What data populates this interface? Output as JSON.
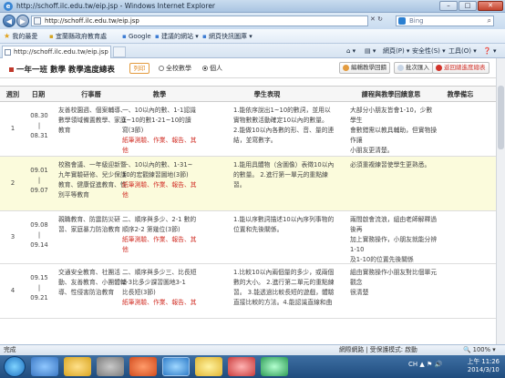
{
  "window": {
    "title": "http://schoff.ilc.edu.tw/eip.jsp - Windows Internet Explorer",
    "ie_logo": "e",
    "minimize": "–",
    "maximize": "□",
    "close": "✕"
  },
  "address": {
    "url": "http://schoff.ilc.edu.tw/eip.jsp",
    "search_placeholder": "Bing",
    "back": "◀",
    "forward": "▶",
    "go": "✕ ↻"
  },
  "favorites": {
    "label": "我的最愛",
    "items": [
      "宜蘭縣政府教育處",
      "Google",
      "建議的網站 ▾",
      "網頁快訊圖庫 ▾"
    ]
  },
  "tabs": {
    "active": "http://schoff.ilc.edu.tw/eip.jsp"
  },
  "commands": {
    "page": "網頁(P) ▾",
    "safety": "安全性(S) ▾",
    "tools": "工具(O) ▾",
    "help": "❓ ▾"
  },
  "header": {
    "title": "一年一班 數學 教學進度總表",
    "print": "列印",
    "radio_all": "全校數學",
    "radio_personal": "個人",
    "btn_edit": "編輯教學回饋",
    "btn_import": "批次匯入",
    "btn_back": "返回總進度總表"
  },
  "columns": [
    "週別",
    "日期",
    "行事曆",
    "教學",
    "學生表現",
    "課程與教學回饋意思",
    "教學備忘"
  ],
  "rows": [
    {
      "week": "1",
      "date_start": "08.30",
      "date_sep": "|",
      "date_end": "08.31",
      "calendar": [
        "友善校園週、個案輔導、",
        "數學領域備置教學、家庭",
        "教育"
      ],
      "teaching": [
        "一、10以內的數、1-1認識",
        "1~10的數1-21~10的讀",
        "寫(3節)"
      ],
      "teaching_red": [
        "紙筆測驗、作業、報告、其",
        "他"
      ],
      "performance": [
        "1.能依序說出1~10的數詞，並用以",
        "實物數數活動確定10以內的數量。",
        "2.能做10以內各數的形、音、量的連",
        "結，並寫數字。"
      ],
      "feedback": [
        "大部分小朋友皆會1-10，少數學生",
        "會數錯需以教具輔助，但實物操作讓",
        "小朋友更清楚。"
      ],
      "memo": []
    },
    {
      "week": "2",
      "date_start": "09.01",
      "date_sep": "|",
      "date_end": "09.07",
      "calendar": [
        "校務會議、一年級迎新暨",
        "九年實驗研修、兒少保護",
        "教育、健康促進教育、性",
        "別平等教育"
      ],
      "teaching": [
        "一、10以內的數、1-31~",
        "10的宏觀練習圖地(3節)"
      ],
      "teaching_red": [
        "紙筆測驗、作業、報告、其",
        "他"
      ],
      "performance": [
        "1.能用具體物（含圖像）表徵10以內",
        "的數量。  2.進行第一單元的重點練",
        "習。"
      ],
      "feedback": [
        "必須重複練習使學生更熟悉。"
      ],
      "memo": []
    },
    {
      "week": "3",
      "date_start": "09.08",
      "date_sep": "|",
      "date_end": "09.14",
      "calendar": [
        "親職教育、防震防災研",
        "習、家庭暴力防治教育"
      ],
      "teaching": [
        "二、順序與多少、2-1 數的",
        "順序2-2 第幾位(3節)"
      ],
      "teaching_red": [
        "紙筆測驗、作業、報告、其",
        "他"
      ],
      "performance": [
        "1.能以序數詞描述10以內序列事物的",
        "位置和先後關係。"
      ],
      "feedback": [
        "兩間啟會流浪，組由老師解釋過後再",
        "加上實務操作，小朋友就能分辨1-10",
        "及1-10的位置先後關係"
      ],
      "memo": []
    },
    {
      "week": "4",
      "date_start": "09.15",
      "date_sep": "|",
      "date_end": "09.21",
      "calendar": [
        "交通安全教育、社團活",
        "動、友善教育、小團體輔",
        "導、性侵害防治教育"
      ],
      "teaching": [
        "二、順序與多少三、比長短",
        "2-3比多少課習圖地3-1",
        "比長短(3節)"
      ],
      "teaching_red": [
        "紙筆測驗、作業、報告、其"
      ],
      "performance": [
        "1.比較10以內兩個量的多少，或兩個",
        "數的大小。  2.進行第二單元的重點練",
        "習。  3.能透過比較長短的遊戲，體驗",
        "直接比較的方法。4.能認識直線和曲"
      ],
      "feedback": [
        "組由實務操作小朋友對比個單元觀念",
        "很清楚"
      ],
      "memo": []
    }
  ],
  "status": {
    "left": "完成",
    "zone": "網際網路 | 受保護模式: 啟動",
    "zoom": "🔍 100% ▾"
  },
  "taskbar": {
    "tray": "CH ▲ ⚑ 🔊",
    "time": "上午 11:26",
    "date": "2014/3/10"
  }
}
